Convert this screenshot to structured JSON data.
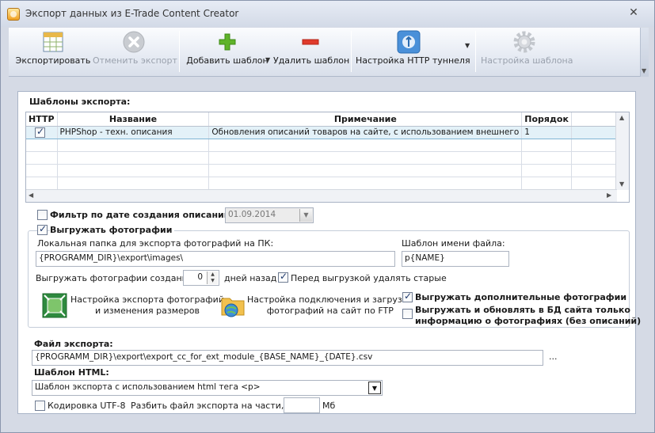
{
  "window": {
    "title": "Экспорт данных из E-Trade Content Creator"
  },
  "toolbar": {
    "export": "Экспортировать",
    "cancel_export": "Отменить экспорт",
    "add_template": "Добавить шаблон",
    "delete_template": "Удалить шаблон",
    "http_tunnel": "Настройка HTTP туннеля",
    "template_settings": "Настройка шаблона"
  },
  "templates": {
    "heading": "Шаблоны экспорта:",
    "columns": [
      "HTTP",
      "Название",
      "Примечание",
      "Порядок"
    ],
    "rows": [
      {
        "http": true,
        "name": "PHPShop - техн. описания",
        "note": "Обновления описаний товаров на сайте, с использованием внешнего",
        "order": "1"
      }
    ]
  },
  "date_filter": {
    "label": "Фильтр по дате создания описаний",
    "checked": false,
    "value": "01.09.2014"
  },
  "photos": {
    "label": "Выгружать фотографии",
    "checked": true,
    "local_folder_label": "Локальная папка для экспорта фотографий на ПК:",
    "local_folder_value": "{PROGRAMM_DIR}\\export\\images\\",
    "filename_template_label": "Шаблон имени файла:",
    "filename_template_value": "p{NAME}",
    "created_prefix": "Выгружать фотографии созданные",
    "days_value": "0",
    "days_suffix": "дней назад",
    "delete_old_label": "Перед выгрузкой удалять старые",
    "delete_old_checked": true,
    "resize_settings": "Настройка экспорта фотографий\nи изменения размеров",
    "ftp_settings": "Настройка подключения и загрузки\nфотографий на сайт по FTP",
    "extra_photos_label": "Выгружать дополнительные фотографии",
    "extra_photos_checked": true,
    "update_db_label": "Выгружать и обновлять в БД сайта только\nинформацию о фотографиях (без описаний)",
    "update_db_checked": false
  },
  "export_file": {
    "label": "Файл экспорта:",
    "value": "{PROGRAMM_DIR}\\export\\export_cc_for_ext_module_{BASE_NAME}_{DATE}.csv",
    "browse": "..."
  },
  "html_template": {
    "label": "Шаблон HTML:",
    "value": "Шаблон экспорта с использованием html тега <p>"
  },
  "encoding": {
    "label": "Кодировка UTF-8",
    "checked": false
  },
  "split": {
    "label": "Разбить файл экспорта на части, по:",
    "value": "",
    "unit": "Мб"
  }
}
